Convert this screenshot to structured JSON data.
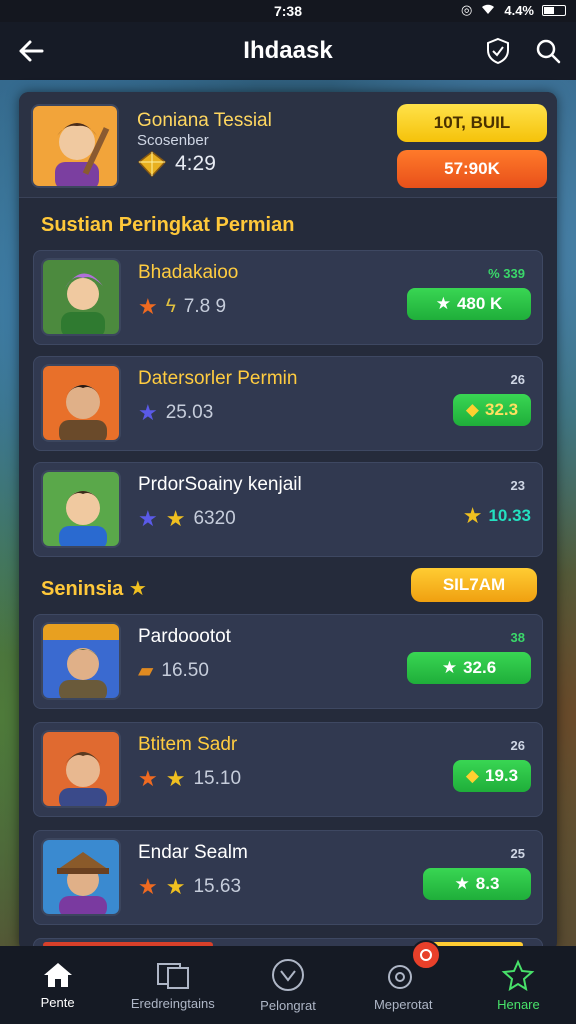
{
  "status": {
    "time": "7:38",
    "signal": "4.4%"
  },
  "app_bar": {
    "title": "Ihdaask"
  },
  "profile": {
    "name": "Goniana Tessial",
    "subname": "Scosenber",
    "gem_value": "4:29",
    "btn_top": "10T, BUIL",
    "btn_bottom": "57:90K"
  },
  "section1": {
    "title": "Sustian Peringkat Permian"
  },
  "players1": [
    {
      "name": "Bhadakaioo",
      "stat": "7.8 9",
      "rank": "% 339",
      "score": "480 K",
      "name_color": "#ffcc40",
      "pill": "green"
    },
    {
      "name": "Datersorler Permin",
      "stat": "25.03",
      "rank": "26",
      "score": "32.3",
      "name_color": "#ffcc40",
      "pill": "green-sm"
    },
    {
      "name": "PrdorSoainy kenjail",
      "stat": "6320",
      "rank": "23",
      "score": "10.33",
      "name_color": "#ffffff",
      "pill": "plain"
    }
  ],
  "section2": {
    "title": "Seninsia",
    "event_chip": "SIL7AM"
  },
  "players2": [
    {
      "name": "Pardoootot",
      "stat": "16.50",
      "rank": "38",
      "score": "32.6",
      "name_color": "#ffffff",
      "pill": "green"
    },
    {
      "name": "Btitem Sadr",
      "stat": "15.10",
      "rank": "26",
      "score": "19.3",
      "name_color": "#ffcc40",
      "pill": "green-sm"
    },
    {
      "name": "Endar Sealm",
      "stat": "15.63",
      "rank": "25",
      "score": "8.3",
      "name_color": "#ffffff",
      "pill": "green"
    }
  ],
  "nav": [
    {
      "label": "Pente"
    },
    {
      "label": "Eredreingtains"
    },
    {
      "label": "Pelongrat"
    },
    {
      "label": "Meperotat"
    },
    {
      "label": "Henare"
    }
  ],
  "colors": {
    "accent_yellow": "#ffc83a",
    "accent_green": "#2cc44a",
    "accent_orange": "#f0601e"
  }
}
